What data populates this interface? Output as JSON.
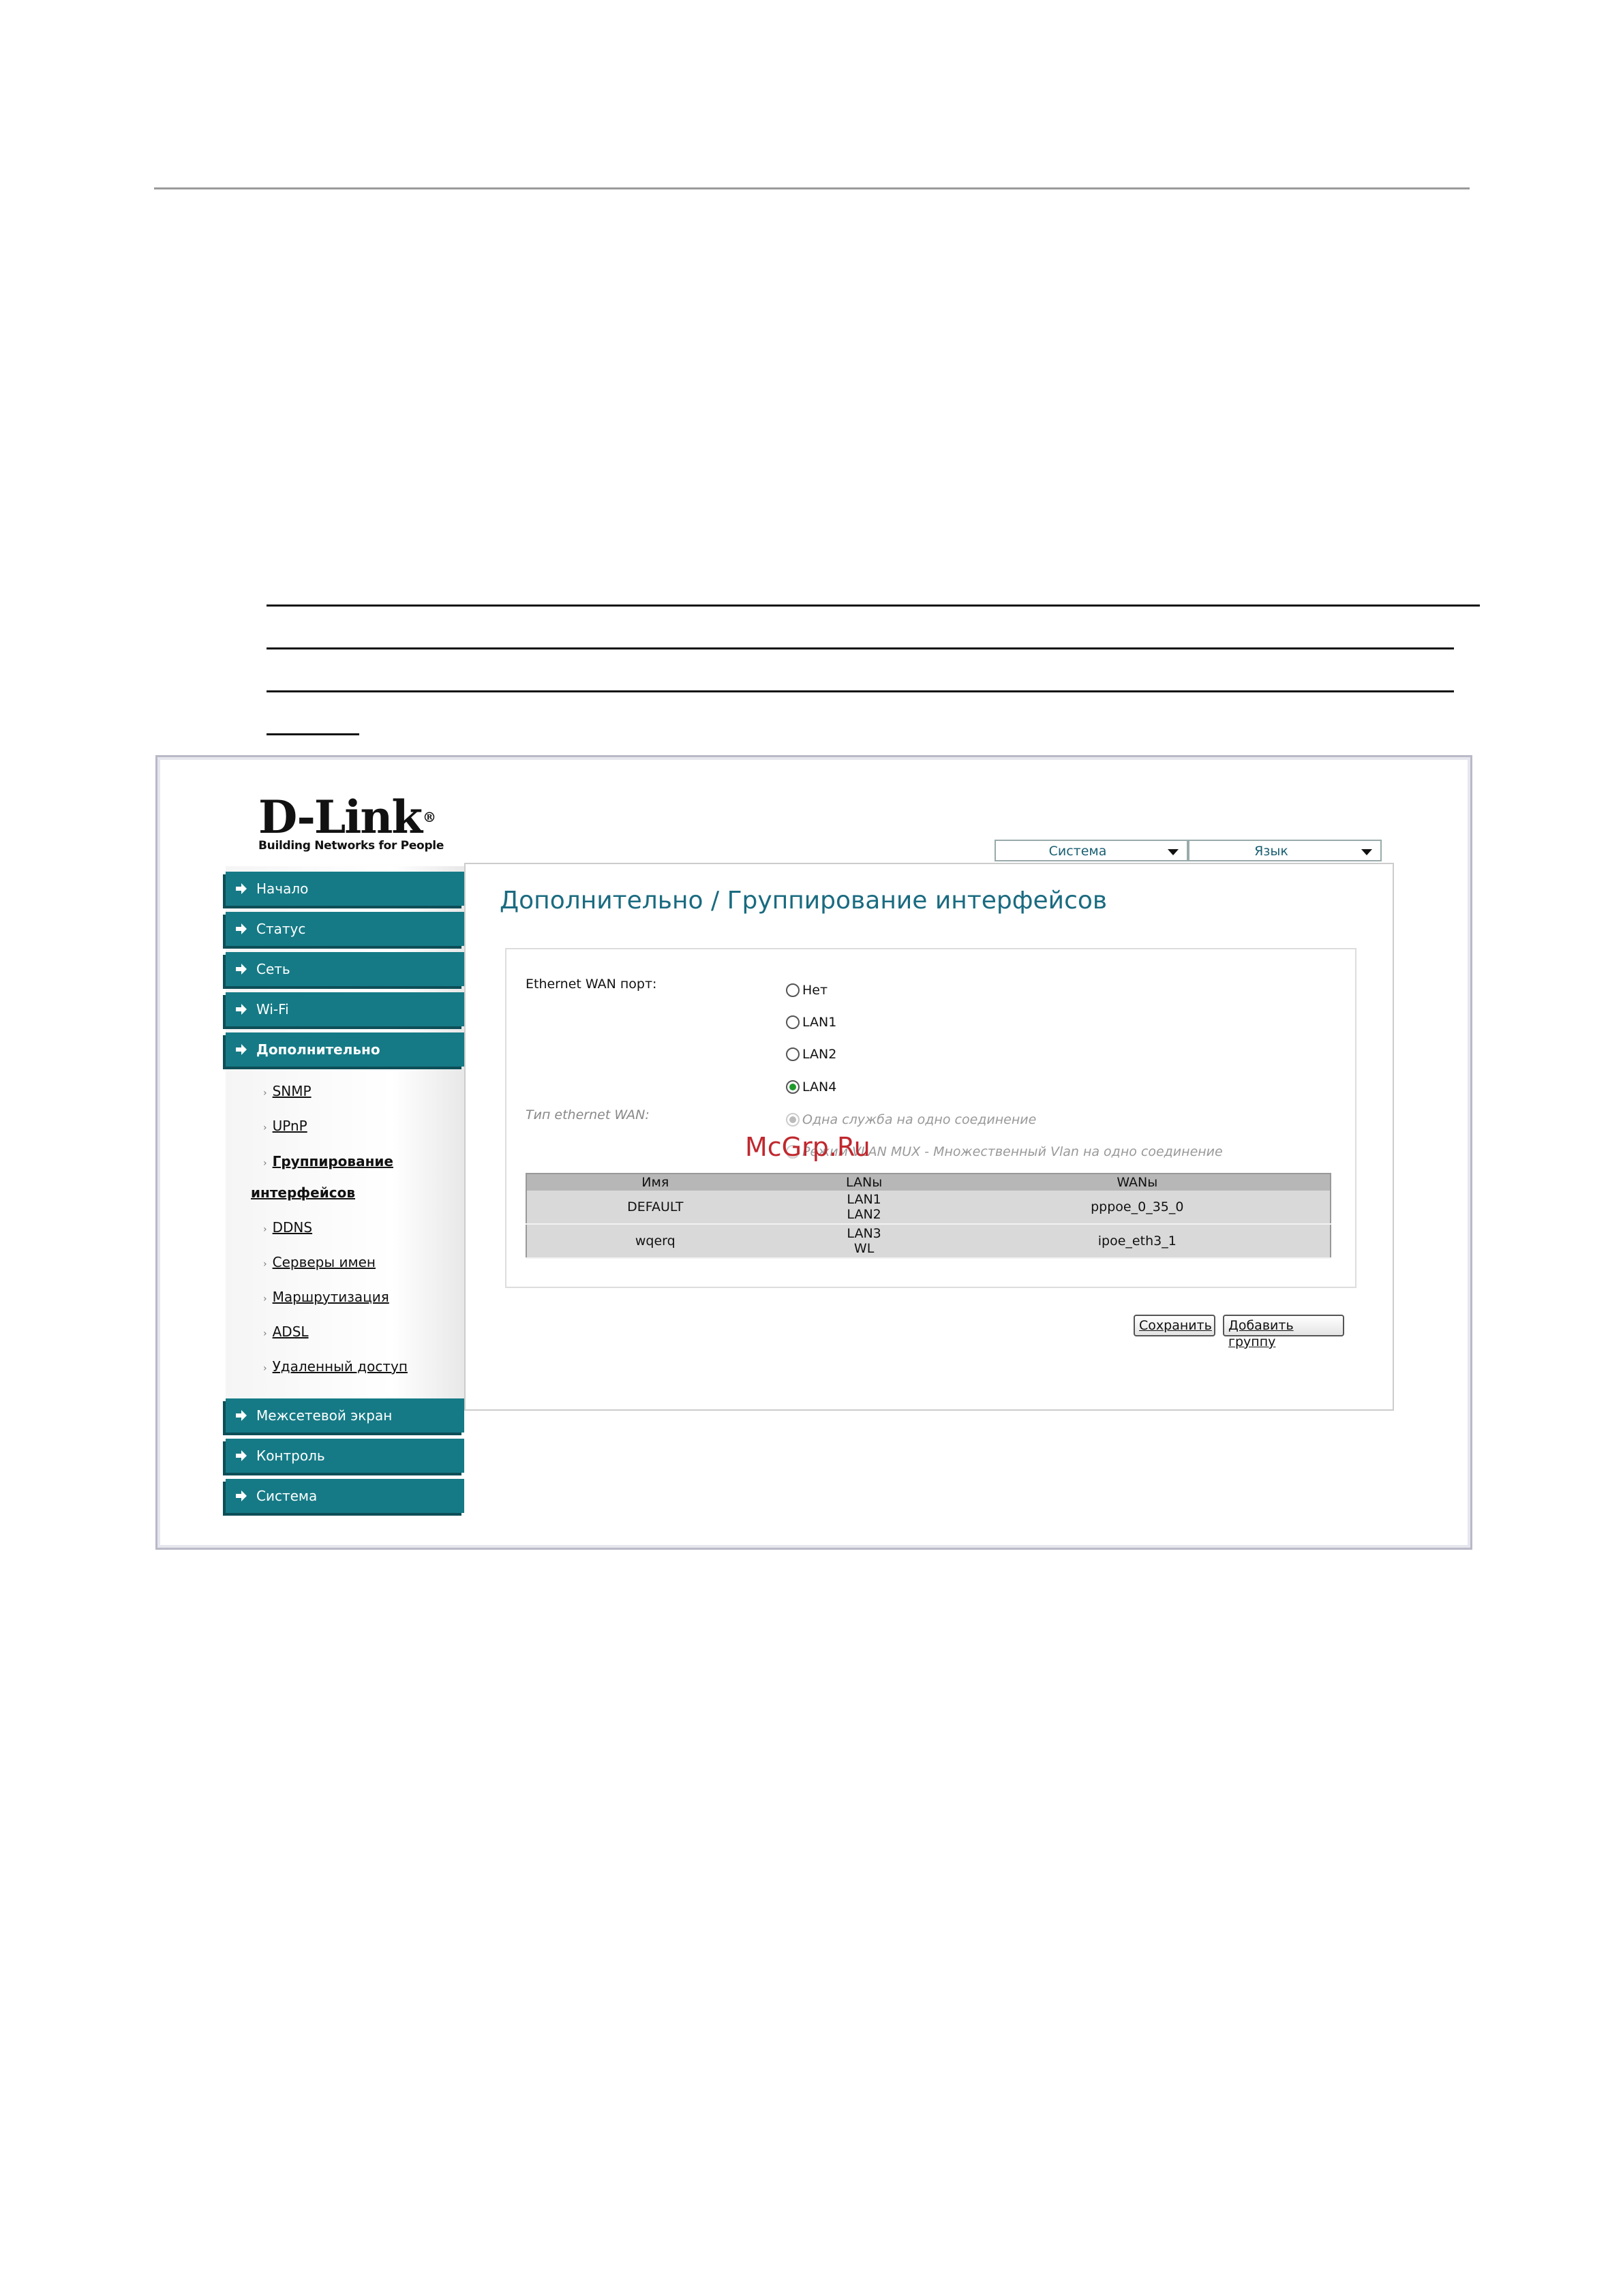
{
  "logo": {
    "brand": "D-Link",
    "tagline": "Building Networks for People"
  },
  "top_menus": [
    {
      "label": "Система"
    },
    {
      "label": "Язык"
    }
  ],
  "nav": {
    "items": [
      {
        "label": "Начало"
      },
      {
        "label": "Статус"
      },
      {
        "label": "Сеть"
      },
      {
        "label": "Wi-Fi"
      },
      {
        "label": "Дополнительно"
      },
      {
        "label": "Межсетевой экран"
      },
      {
        "label": "Контроль"
      },
      {
        "label": "Система"
      }
    ],
    "subitems": [
      {
        "label": "SNMP"
      },
      {
        "label": "UPnP"
      },
      {
        "label": "Группирование"
      },
      {
        "label": "интерфейсов"
      },
      {
        "label": "DDNS"
      },
      {
        "label": "Серверы имен"
      },
      {
        "label": "Маршрутизация"
      },
      {
        "label": "ADSL"
      },
      {
        "label": "Удаленный доступ"
      }
    ]
  },
  "page": {
    "title": "Дополнительно / Группирование интерфейсов"
  },
  "form": {
    "wan_port_label": "Ethernet WAN порт:",
    "wan_port_options": [
      {
        "label": "Нет",
        "checked": false
      },
      {
        "label": "LAN1",
        "checked": false
      },
      {
        "label": "LAN2",
        "checked": false
      },
      {
        "label": "LAN4",
        "checked": true
      }
    ],
    "wan_type_label": "Тип ethernet WAN:",
    "wan_type_options": [
      {
        "label": "Одна служба на одно соединение",
        "checked": true
      },
      {
        "label": "Режим VLAN MUX - Множественный Vlan на одно соединение",
        "checked": false
      }
    ]
  },
  "watermark": "McGrp.Ru",
  "table": {
    "headers": [
      "Имя",
      "LANы",
      "WANы"
    ],
    "rows": [
      {
        "name": "DEFAULT",
        "lan1": "LAN1",
        "lan2": "LAN2",
        "wan": "pppoe_0_35_0"
      },
      {
        "name": "wqerq",
        "lan1": "LAN3",
        "lan2": "WL",
        "wan": "ipoe_eth3_1"
      }
    ]
  },
  "buttons": {
    "save": "Сохранить",
    "add_group": "Добавить группу"
  },
  "colors": {
    "nav_bg": "#157a86",
    "title": "#1a6b80",
    "watermark": "#c0282e"
  }
}
